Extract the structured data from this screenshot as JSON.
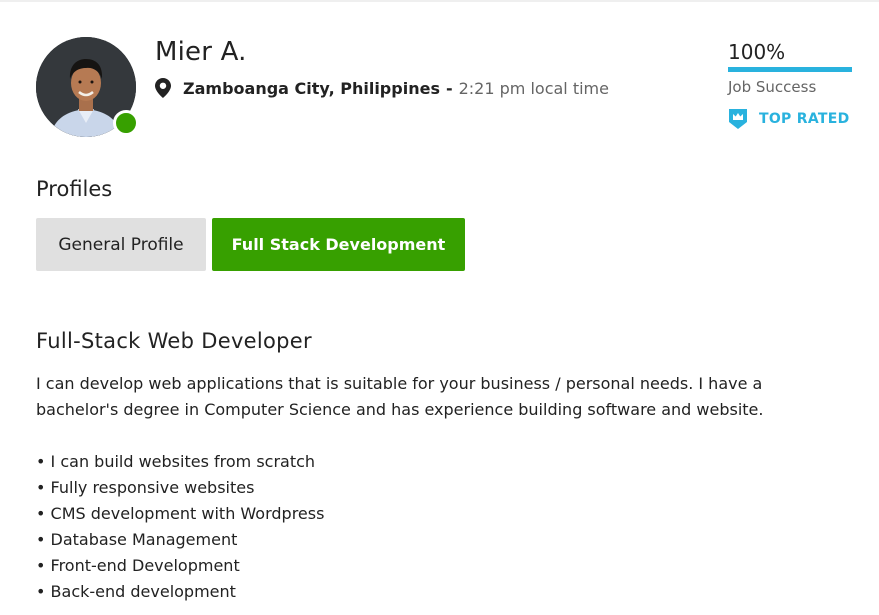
{
  "colors": {
    "upwork_green": "#37a000",
    "accent_blue": "#29b2de",
    "tab_gray": "#e0e0e0",
    "muted_text": "#656565"
  },
  "freelancer": {
    "name": "Mier A.",
    "avatar_icon": "profile-photo",
    "online_status": "online",
    "location": {
      "city": "Zamboanga City, Philippines",
      "separator": "-",
      "local_time": "2:21 pm local time"
    }
  },
  "stats": {
    "job_success_percent": "100%",
    "job_success_fraction": 1.0,
    "job_success_label": "Job Success",
    "badge_label": "TOP RATED",
    "badge_icon": "top-rated-badge-icon"
  },
  "profiles": {
    "heading": "Profiles",
    "tabs": [
      {
        "label": "General Profile",
        "selected": false
      },
      {
        "label": "Full Stack Development",
        "selected": true
      }
    ]
  },
  "overview": {
    "title": "Full-Stack Web Developer",
    "paragraph_lines": [
      "I can develop web applications that is suitable for your business / personal needs. I have a",
      "bachelor's degree in Computer Science and has experience building software and website."
    ],
    "bullets": [
      "I can build websites from scratch",
      "Fully responsive websites",
      "CMS development with Wordpress",
      "Database Management",
      "Front-end Development",
      "Back-end development"
    ]
  }
}
